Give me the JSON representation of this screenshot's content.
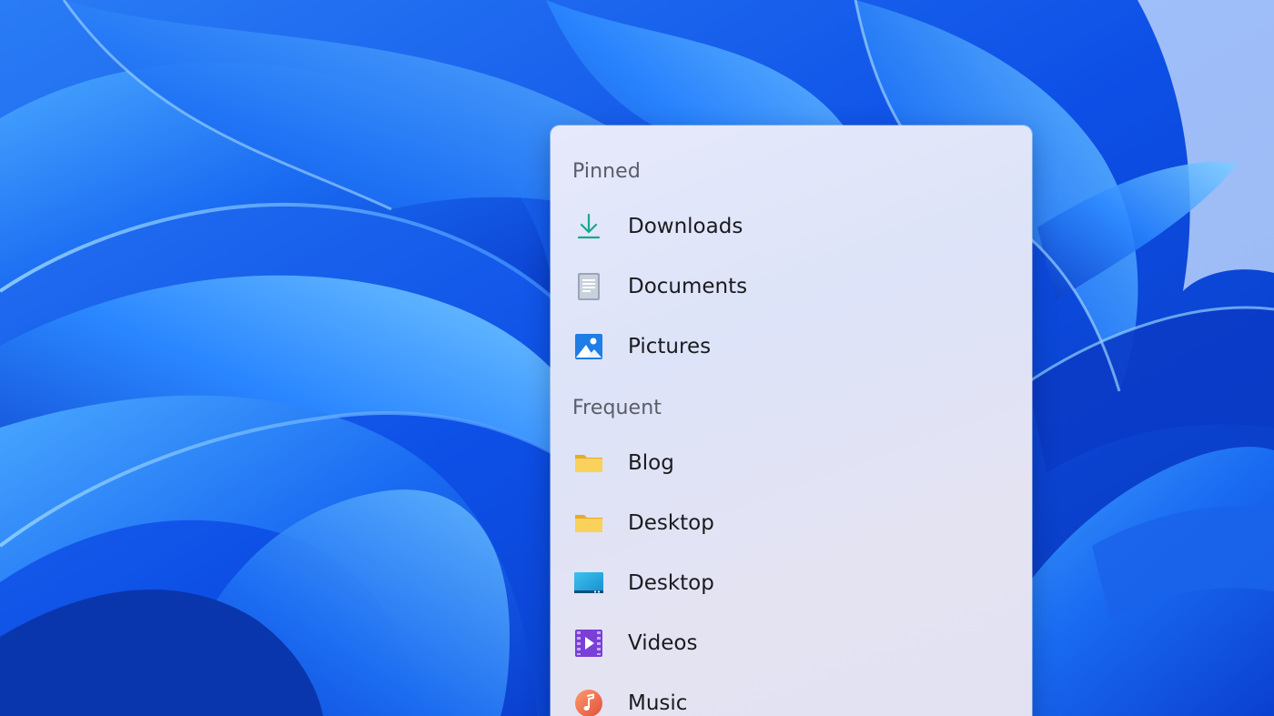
{
  "colors": {
    "panel_background": "#e3e6f7",
    "section_header": "#5a5d66",
    "item_text": "#1b1b1f",
    "download_accent": "#1aa88a",
    "folder_yellow": "#f6c94c",
    "wallpaper_blue": "#0a4fe0"
  },
  "jumplist": {
    "sections": [
      {
        "title": "Pinned",
        "items": [
          {
            "label": "Downloads",
            "icon": "download-arrow-icon"
          },
          {
            "label": "Documents",
            "icon": "document-icon"
          },
          {
            "label": "Pictures",
            "icon": "pictures-icon"
          }
        ]
      },
      {
        "title": "Frequent",
        "items": [
          {
            "label": "Blog",
            "icon": "folder-icon"
          },
          {
            "label": "Desktop",
            "icon": "folder-icon"
          },
          {
            "label": "Desktop",
            "icon": "desktop-icon"
          },
          {
            "label": "Videos",
            "icon": "videos-icon"
          },
          {
            "label": "Music",
            "icon": "music-icon"
          }
        ]
      }
    ]
  }
}
